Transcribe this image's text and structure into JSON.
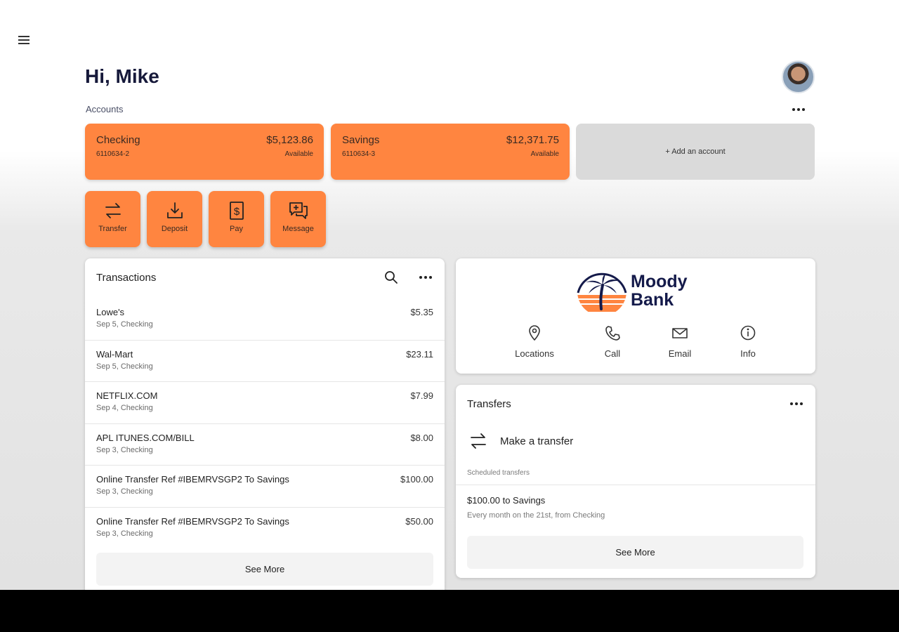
{
  "user": {
    "greeting": "Hi, Mike"
  },
  "accounts": {
    "label": "Accounts",
    "items": [
      {
        "name": "Checking",
        "number": "6110634-2",
        "balance": "$5,123.86",
        "status": "Available"
      },
      {
        "name": "Savings",
        "number": "6110634-3",
        "balance": "$12,371.75",
        "status": "Available"
      }
    ],
    "add_label": "+ Add an account"
  },
  "actions": [
    {
      "label": "Transfer",
      "icon": "transfer-icon"
    },
    {
      "label": "Deposit",
      "icon": "deposit-icon"
    },
    {
      "label": "Pay",
      "icon": "pay-icon"
    },
    {
      "label": "Message",
      "icon": "message-icon"
    }
  ],
  "transactions": {
    "title": "Transactions",
    "items": [
      {
        "name": "Lowe's",
        "sub": "Sep 5, Checking",
        "amount": "$5.35"
      },
      {
        "name": "Wal-Mart",
        "sub": "Sep 5, Checking",
        "amount": "$23.11"
      },
      {
        "name": "NETFLIX.COM",
        "sub": "Sep 4, Checking",
        "amount": "$7.99"
      },
      {
        "name": "APL ITUNES.COM/BILL",
        "sub": "Sep 3, Checking",
        "amount": "$8.00"
      },
      {
        "name": "Online Transfer Ref #IBEMRVSGP2 To Savings",
        "sub": "Sep 3, Checking",
        "amount": "$100.00"
      },
      {
        "name": "Online Transfer Ref #IBEMRVSGP2 To Savings",
        "sub": "Sep 3, Checking",
        "amount": "$50.00"
      }
    ],
    "see_more": "See More"
  },
  "bank": {
    "name_line1": "Moody",
    "name_line2": "Bank",
    "links": [
      {
        "label": "Locations",
        "icon": "location-pin-icon"
      },
      {
        "label": "Call",
        "icon": "phone-icon"
      },
      {
        "label": "Email",
        "icon": "email-icon"
      },
      {
        "label": "Info",
        "icon": "info-icon"
      }
    ]
  },
  "transfers": {
    "title": "Transfers",
    "make_transfer": "Make a transfer",
    "scheduled_label": "Scheduled transfers",
    "scheduled": [
      {
        "title": "$100.00 to Savings",
        "detail": "Every month on the 21st, from Checking"
      }
    ],
    "see_more": "See More"
  },
  "colors": {
    "accent": "#ff8540",
    "navy": "#141a4a",
    "add_account_bg": "#dadada"
  }
}
